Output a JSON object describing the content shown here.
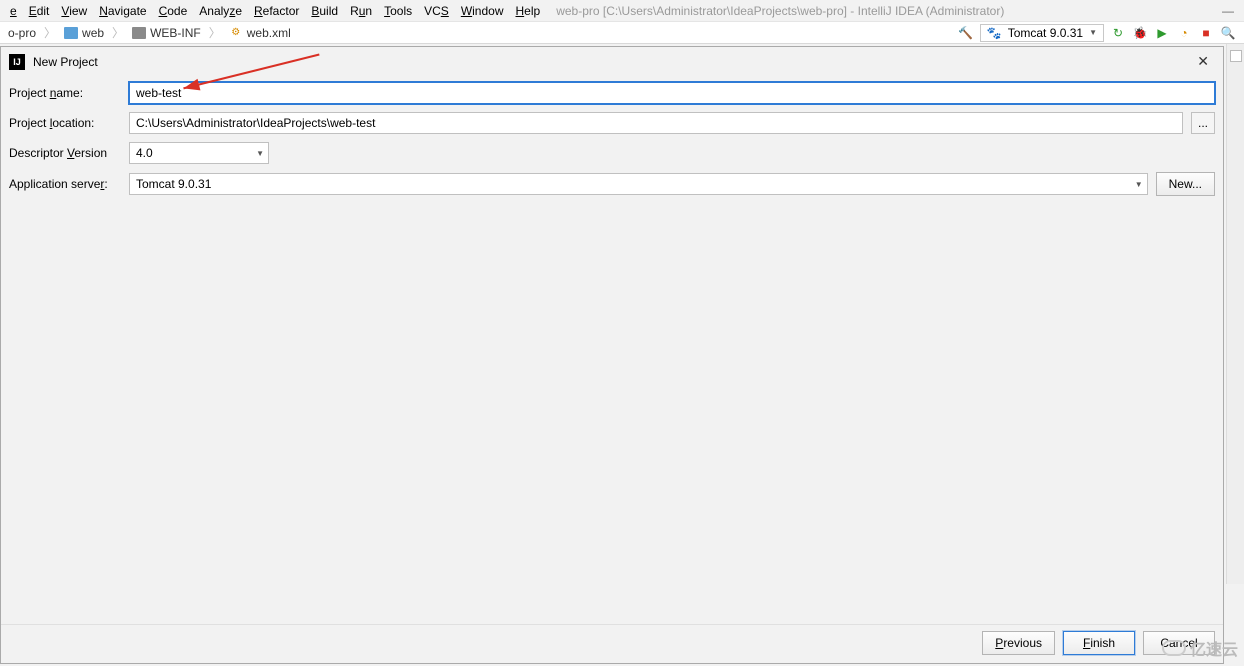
{
  "menubar": {
    "items": [
      {
        "pre": "",
        "key": "e",
        "post": ""
      },
      {
        "pre": "",
        "key": "E",
        "post": "dit"
      },
      {
        "pre": "",
        "key": "V",
        "post": "iew"
      },
      {
        "pre": "",
        "key": "N",
        "post": "avigate"
      },
      {
        "pre": "",
        "key": "C",
        "post": "ode"
      },
      {
        "pre": "Analy",
        "key": "z",
        "post": "e"
      },
      {
        "pre": "",
        "key": "R",
        "post": "efactor"
      },
      {
        "pre": "",
        "key": "B",
        "post": "uild"
      },
      {
        "pre": "R",
        "key": "u",
        "post": "n"
      },
      {
        "pre": "",
        "key": "T",
        "post": "ools"
      },
      {
        "pre": "VC",
        "key": "S",
        "post": ""
      },
      {
        "pre": "",
        "key": "W",
        "post": "indow"
      },
      {
        "pre": "",
        "key": "H",
        "post": "elp"
      }
    ],
    "title": "web-pro [C:\\Users\\Administrator\\IdeaProjects\\web-pro] - IntelliJ IDEA (Administrator)"
  },
  "breadcrumbs": {
    "items": [
      "o-pro",
      "web",
      "WEB-INF",
      "web.xml"
    ]
  },
  "run_config": {
    "selected": "Tomcat 9.0.31"
  },
  "toolbar_icons": [
    "reload-icon",
    "debug-icon",
    "profile-icon",
    "retry-icon",
    "stop-icon",
    "search-icon"
  ],
  "dialog": {
    "title": "New Project",
    "close": "✕",
    "fields": {
      "project_name_label_pre": "Project ",
      "project_name_key": "n",
      "project_name_label_post": "ame:",
      "project_name_value": "web-test",
      "project_location_label_pre": "Project ",
      "project_location_key": "l",
      "project_location_label_post": "ocation:",
      "project_location_value": "C:\\Users\\Administrator\\IdeaProjects\\web-test",
      "descriptor_version_label_pre": "Descriptor ",
      "descriptor_version_key": "V",
      "descriptor_version_label_post": "ersion",
      "descriptor_version_value": "4.0",
      "app_server_label_pre": "Application serve",
      "app_server_key": "r",
      "app_server_label_post": ":",
      "app_server_value": "Tomcat 9.0.31",
      "browse": "...",
      "new_server": "New..."
    },
    "buttons": {
      "previous_pre": "",
      "previous_key": "P",
      "previous_post": "revious",
      "finish_pre": "",
      "finish_key": "F",
      "finish_post": "inish",
      "cancel": "Cancel"
    }
  },
  "watermark": "亿速云"
}
